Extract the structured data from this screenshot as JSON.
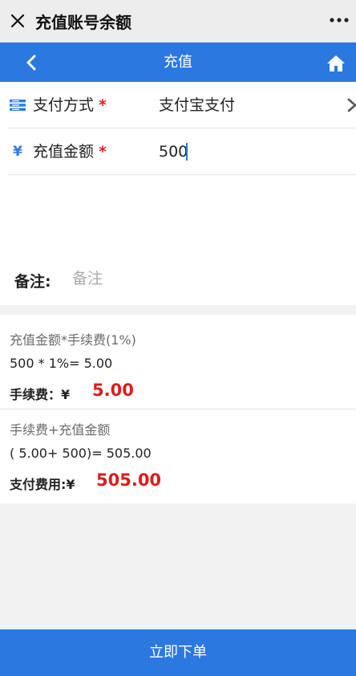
{
  "window": {
    "title": "充值账号余额"
  },
  "nav": {
    "title": "充值"
  },
  "form": {
    "payment": {
      "label": "支付方式",
      "required_mark": "*",
      "value": "支付宝支付"
    },
    "amount": {
      "label": "充值金额",
      "required_mark": "*",
      "value": "500",
      "icon_glyph": "¥"
    },
    "remark": {
      "label": "备注:",
      "placeholder": "备注"
    }
  },
  "fees": {
    "formula1": "充值金额*手续费(1%)",
    "calc1": "500 * 1%= 5.00",
    "fee_label": "手续费：¥",
    "fee_value": "5.00",
    "formula2": "手续费+充值金额",
    "calc2": "( 5.00+ 500)= 505.00",
    "total_label": "支付费用:¥",
    "total_value": "505.00"
  },
  "submit": {
    "label": "立即下单"
  },
  "colors": {
    "accent": "#2b79e0",
    "highlight": "#dc1c1c"
  }
}
